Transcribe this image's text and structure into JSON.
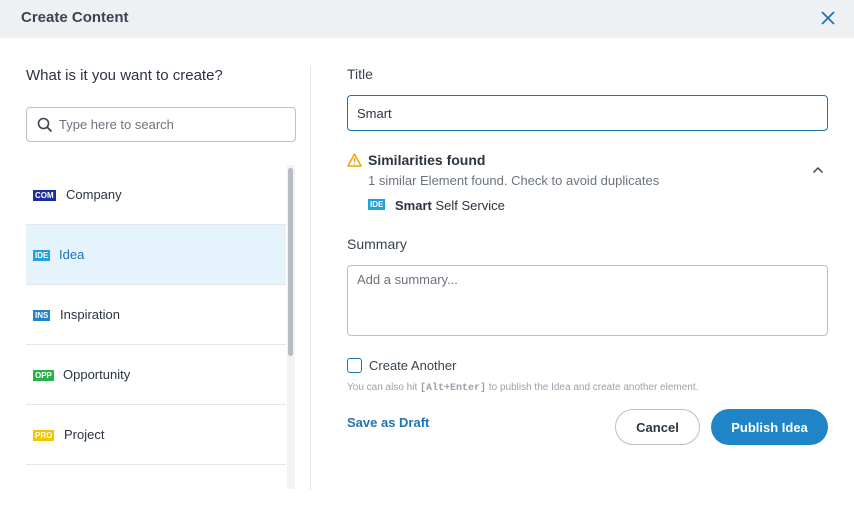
{
  "header": {
    "title": "Create Content",
    "close_icon": "close-icon"
  },
  "left": {
    "heading": "What is it you want to create?",
    "search": {
      "placeholder": "Type here to search",
      "value": ""
    },
    "items": [
      {
        "badge": "COM",
        "label": "Company",
        "badge_bg": "#1c2f9c",
        "badge_fg": "#ffffff",
        "selected": false
      },
      {
        "badge": "IDE",
        "label": "Idea",
        "badge_bg": "#1fa3da",
        "badge_fg": "#ffffff",
        "selected": true
      },
      {
        "badge": "INS",
        "label": "Inspiration",
        "badge_bg": "#1f84c8",
        "badge_fg": "#ffffff",
        "selected": false
      },
      {
        "badge": "OPP",
        "label": "Opportunity",
        "badge_bg": "#29b24a",
        "badge_fg": "#ffffff",
        "selected": false
      },
      {
        "badge": "PRO",
        "label": "Project",
        "badge_bg": "#f2c500",
        "badge_fg": "#ffffff",
        "selected": false
      }
    ]
  },
  "form": {
    "title_label": "Title",
    "title_value": "Smart",
    "similarities": {
      "title": "Similarities found",
      "subtitle": "1 similar Element found. Check to avoid duplicates",
      "item_badge": "IDE",
      "item_bold": "Smart",
      "item_rest": " Self Service"
    },
    "summary_label": "Summary",
    "summary_placeholder": "Add a summary...",
    "create_another_label": "Create Another",
    "hint_before": "You can also hit ",
    "hint_key": "[Alt+Enter]",
    "hint_after": " to publish the Idea and create another element.",
    "save_draft_label": "Save as Draft",
    "cancel_label": "Cancel",
    "publish_label": "Publish Idea"
  },
  "colors": {
    "accent": "#1d74b5",
    "primary_button": "#1f84c8",
    "warning": "#f0a500",
    "selected_row": "#e5f3fd"
  }
}
